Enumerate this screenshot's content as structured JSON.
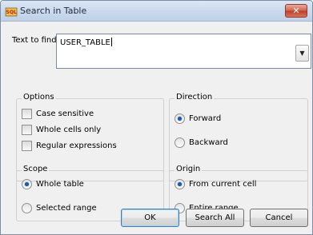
{
  "window": {
    "title": "Search in Table",
    "close_glyph": "✕",
    "app_icon": "sql-table-icon"
  },
  "find": {
    "label": "Text to find:",
    "value": "USER_TABLE",
    "dropdown_glyph": "▼"
  },
  "options": {
    "title": "Options",
    "items": [
      {
        "label": "Case sensitive",
        "checked": false
      },
      {
        "label": "Whole cells only",
        "checked": false
      },
      {
        "label": "Regular expressions",
        "checked": false
      }
    ]
  },
  "direction": {
    "title": "Direction",
    "items": [
      {
        "label": "Forward",
        "checked": true
      },
      {
        "label": "Backward",
        "checked": false
      }
    ]
  },
  "scope": {
    "title": "Scope",
    "items": [
      {
        "label": "Whole table",
        "checked": true
      },
      {
        "label": "Selected range",
        "checked": false
      }
    ]
  },
  "origin": {
    "title": "Origin",
    "items": [
      {
        "label": "From current cell",
        "checked": true
      },
      {
        "label": "Entire range",
        "checked": false
      }
    ]
  },
  "buttons": {
    "ok": "OK",
    "search_all": "Search All",
    "cancel": "Cancel"
  },
  "colors": {
    "titlebar": "#cbdaee",
    "close_button": "#c0402a",
    "default_button_border": "#3c7fb1"
  }
}
